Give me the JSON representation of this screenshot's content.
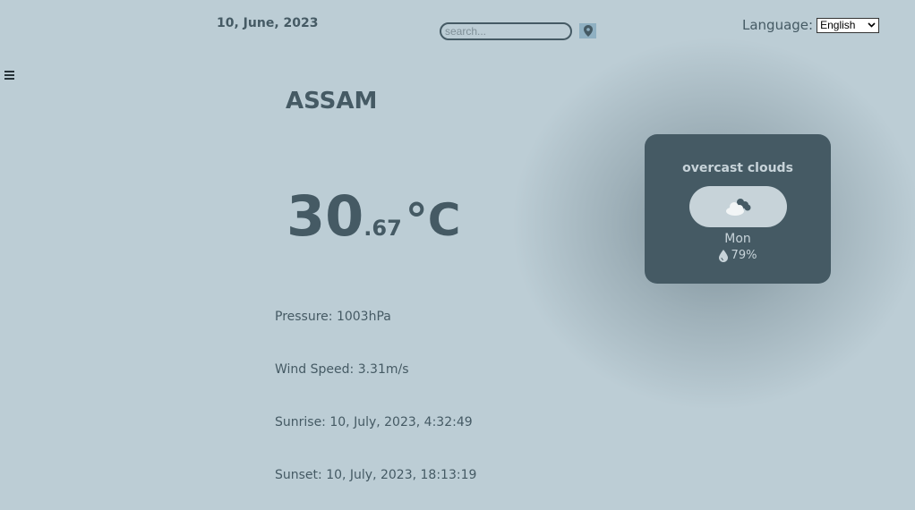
{
  "header": {
    "date": "10, June, 2023",
    "search_placeholder": "search...",
    "language_label": "Language:",
    "language_selected": "English"
  },
  "main": {
    "city": "ASSAM",
    "temp_int": "30",
    "temp_dec": ".67",
    "temp_unit": "°C",
    "pressure": "Pressure: 1003hPa",
    "wind": "Wind Speed: 3.31m/s",
    "sunrise": "Sunrise: 10, July, 2023, 4:32:49",
    "sunset": "Sunset: 10, July, 2023, 18:13:19"
  },
  "forecast": {
    "description": "overcast clouds",
    "icon": "cloud-icon",
    "day": "Mon",
    "humidity": "79%"
  },
  "colors": {
    "background": "#bccdd5",
    "card": "#455a64",
    "text": "#455a64",
    "card_text": "#c7d3d9"
  }
}
